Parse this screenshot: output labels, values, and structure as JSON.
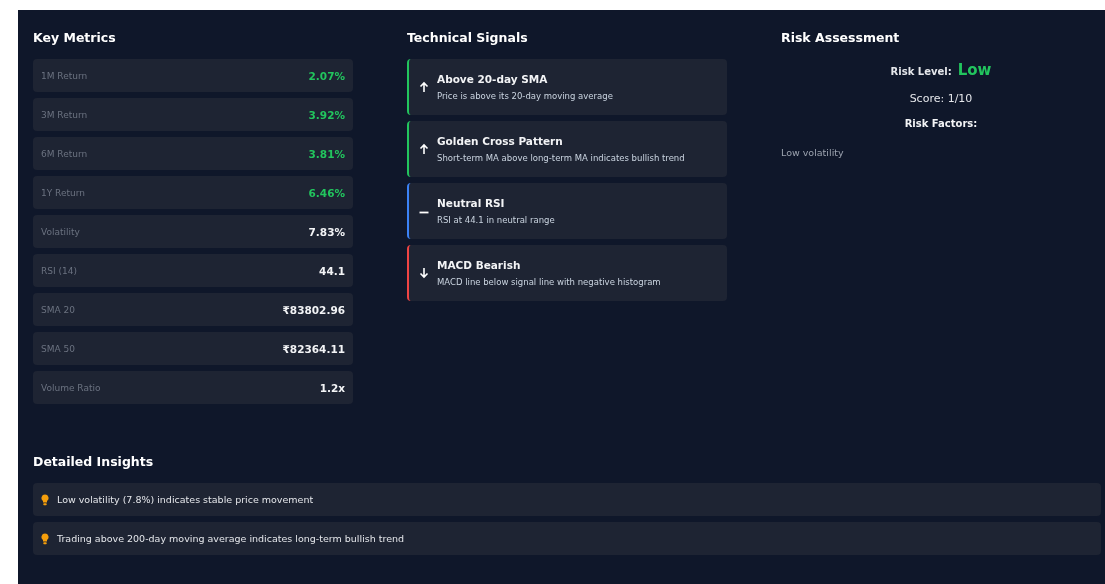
{
  "key_metrics": {
    "title": "Key Metrics",
    "rows": [
      {
        "label": "1M Return",
        "value": "2.07%",
        "color": "#22c55e"
      },
      {
        "label": "3M Return",
        "value": "3.92%",
        "color": "#22c55e"
      },
      {
        "label": "6M Return",
        "value": "3.81%",
        "color": "#22c55e"
      },
      {
        "label": "1Y Return",
        "value": "6.46%",
        "color": "#22c55e"
      },
      {
        "label": "Volatility",
        "value": "7.83%",
        "color": "#f3f4f6"
      },
      {
        "label": "RSI (14)",
        "value": "44.1",
        "color": "#f3f4f6"
      },
      {
        "label": "SMA 20",
        "value": "₹83802.96",
        "color": "#f3f4f6"
      },
      {
        "label": "SMA 50",
        "value": "₹82364.11",
        "color": "#f3f4f6"
      },
      {
        "label": "Volume Ratio",
        "value": "1.2x",
        "color": "#f3f4f6"
      }
    ]
  },
  "technical_signals": {
    "title": "Technical Signals",
    "items": [
      {
        "kind": "bullish",
        "title": "Above 20-day SMA",
        "description": "Price is above its 20-day moving average"
      },
      {
        "kind": "bullish",
        "title": "Golden Cross Pattern",
        "description": "Short-term MA above long-term MA indicates bullish trend"
      },
      {
        "kind": "neutral",
        "title": "Neutral RSI",
        "description": "RSI at 44.1 in neutral range"
      },
      {
        "kind": "bearish",
        "title": "MACD Bearish",
        "description": "MACD line below signal line with negative histogram"
      }
    ]
  },
  "risk_assessment": {
    "title": "Risk Assessment",
    "level_label": "Risk Level:",
    "level": {
      "text": "Low",
      "color": "#22c55e"
    },
    "score": "Score: 1/10",
    "factors_title": "Risk Factors:",
    "factors": [
      "Low volatility"
    ]
  },
  "detailed_insights": {
    "title": "Detailed Insights",
    "items": [
      "Low volatility (7.8%) indicates stable price movement",
      "Trading above 200-day moving average indicates long-term bullish trend"
    ]
  }
}
